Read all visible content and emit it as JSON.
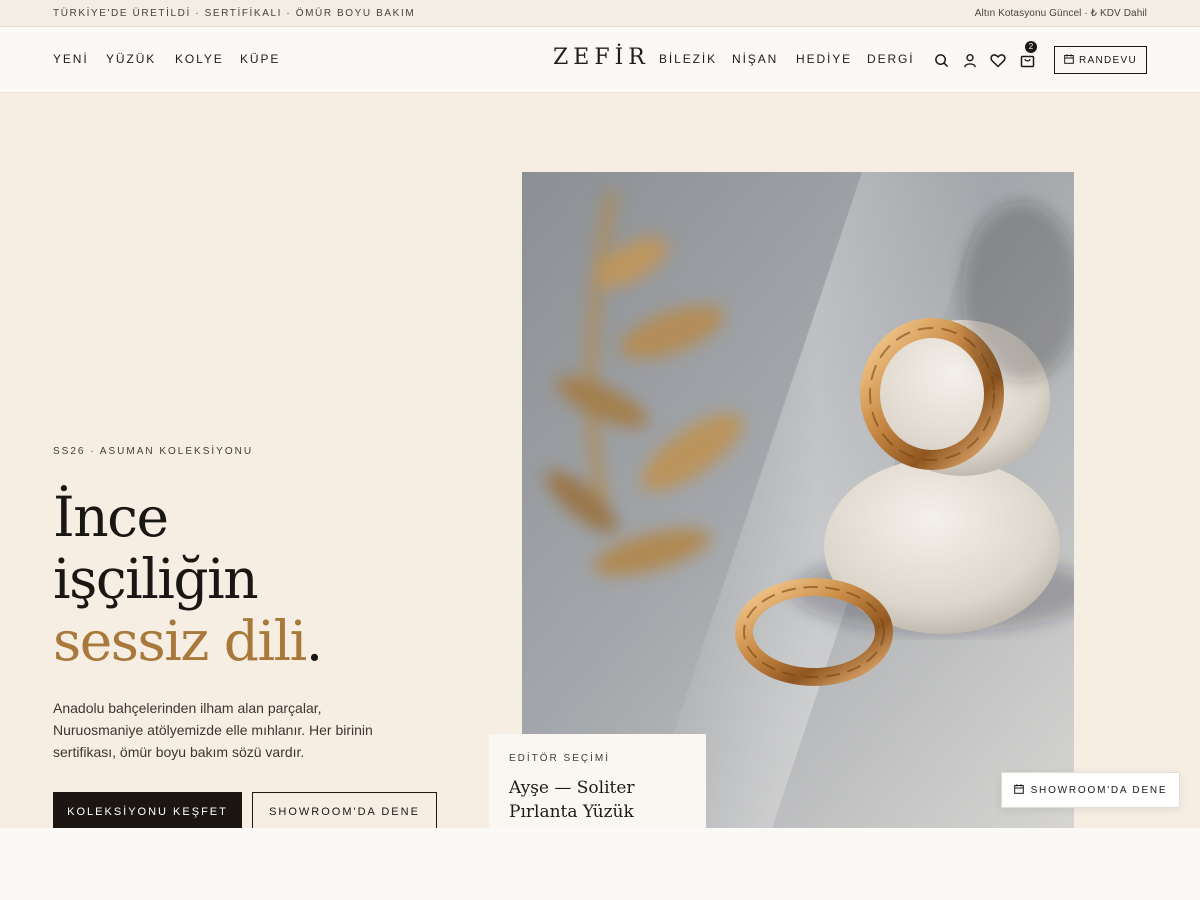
{
  "topbar": {
    "left": "TÜRKİYE'DE ÜRETİLDİ · SERTİFİKALI · ÖMÜR BOYU BAKIM",
    "right": "Altın Kotasyonu Güncel · ₺ KDV Dahil"
  },
  "header": {
    "logo": "ZEFİR",
    "nav_left": [
      "YENİ",
      "YÜZÜK",
      "KOLYE",
      "KÜPE"
    ],
    "nav_right": [
      "BİLEZİK",
      "NİŞAN",
      "HEDİYE",
      "DERGİ"
    ],
    "icons": [
      "search-icon",
      "user-icon",
      "heart-icon",
      "bag-icon"
    ],
    "cart_count": "2",
    "appointment_label": "RANDEVU"
  },
  "hero": {
    "eyebrow": "SS26 · ASUMAN KOLEKSİYONU",
    "headline_line1": "İnce",
    "headline_line2": "işçiliğin",
    "headline_line3_accent": "sessiz dili",
    "headline_period": ".",
    "description": "Anadolu bahçelerinden ilham alan parçalar, Nuruosmaniye atölyemizde elle mıhlanır. Her birinin sertifikası, ömür boyu bakım sözü vardır.",
    "primary_cta": "KOLEKSİYONU KEŞFET",
    "secondary_cta": "SHOWROOM'DA DENE"
  },
  "editor_card": {
    "label": "EDİTÖR SEÇİMİ",
    "title": "Ayşe — Soliter Pırlanta Yüzük"
  },
  "floating_button": {
    "label": "SHOWROOM'DA DENE"
  },
  "colors": {
    "accent": "#a9793c",
    "hero_bg": "#f6eee3",
    "ink": "#1c1815"
  }
}
